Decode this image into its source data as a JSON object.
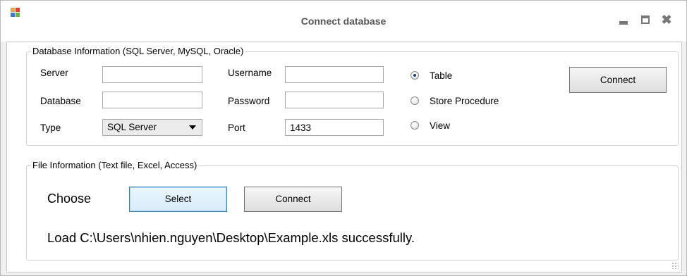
{
  "window": {
    "title": "Connect database",
    "close_glyph": "✖"
  },
  "db_group": {
    "legend": "Database Information (SQL Server, MySQL, Oracle)",
    "server_label": "Server",
    "server_value": "",
    "database_label": "Database",
    "database_value": "",
    "type_label": "Type",
    "type_value": "SQL Server",
    "username_label": "Username",
    "username_value": "",
    "password_label": "Password",
    "password_value": "",
    "port_label": "Port",
    "port_value": "1433",
    "radios": [
      {
        "label": "Table",
        "selected": true
      },
      {
        "label": "Store Procedure",
        "selected": false
      },
      {
        "label": "View",
        "selected": false
      }
    ],
    "connect_label": "Connect"
  },
  "file_group": {
    "legend": "File Information (Text file, Excel, Access)",
    "choose_label": "Choose",
    "select_label": "Select",
    "connect_label": "Connect",
    "status_text": "Load C:\\Users\\nhien.nguyen\\Desktop\\Example.xls successfully."
  },
  "icons": [
    "app-icon",
    "minimize-icon",
    "maximize-icon",
    "close-icon",
    "dropdown-arrow-icon",
    "resize-grip-icon"
  ]
}
